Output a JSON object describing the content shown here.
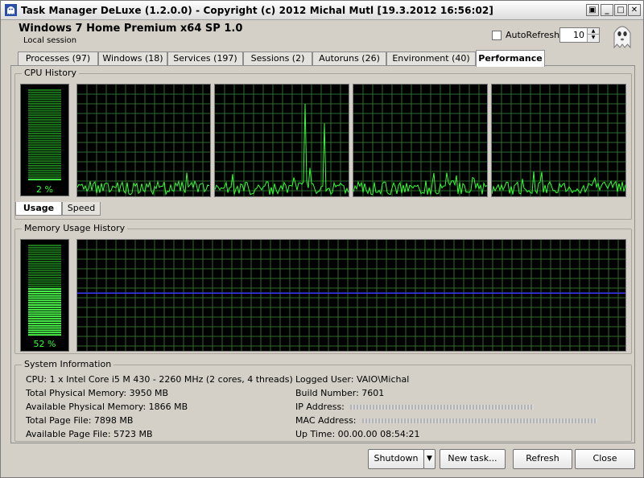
{
  "window": {
    "title": "Task Manager DeLuxe (1.2.0.0) - Copyright (c) 2012 Michal Mutl    [19.3.2012 16:56:02]"
  },
  "header": {
    "os": "Windows 7 Home Premium x64 SP 1.0",
    "session": "Local session",
    "autorefresh_label": "AutoRefresh",
    "autorefresh_checked": false,
    "refresh_interval": "10"
  },
  "tabs": [
    {
      "label": "Processes (97)"
    },
    {
      "label": "Windows (18)"
    },
    {
      "label": "Services (197)"
    },
    {
      "label": "Sessions (2)"
    },
    {
      "label": "Autoruns (26)"
    },
    {
      "label": "Environment (40)"
    },
    {
      "label": "Performance",
      "active": true
    }
  ],
  "cpu": {
    "group_label": "CPU History",
    "usage_value": 0.02,
    "usage_label": "2 %",
    "subtabs": [
      "Usage",
      "Speed"
    ],
    "active_subtab": "Usage"
  },
  "memory": {
    "group_label": "Memory Usage History",
    "usage_value": 0.52,
    "usage_label": "52 %"
  },
  "system": {
    "group_label": "System Information",
    "left": [
      "CPU: 1 x Intel Core i5 M 430 - 2260 MHz (2 cores, 4 threads)",
      "Total Physical Memory: 3950 MB",
      "Available Physical Memory: 1866 MB",
      "Total Page File: 7898 MB",
      "Available Page File: 5723 MB"
    ],
    "right": [
      "Logged User: VAIO\\Michal",
      "Build Number: 7601",
      "IP Address:",
      "MAC Address:",
      "Up Time: 00.00.00 08:54:21"
    ]
  },
  "buttons": {
    "shutdown": "Shutdown",
    "new_task": "New task...",
    "refresh": "Refresh",
    "close": "Close"
  },
  "colors": {
    "graph_line": "#33ff33",
    "grid": "#2e6b2e",
    "memory_line": "#3a3aff"
  },
  "icons": {
    "app": "ghost-icon",
    "mascot": "ghost-icon"
  }
}
